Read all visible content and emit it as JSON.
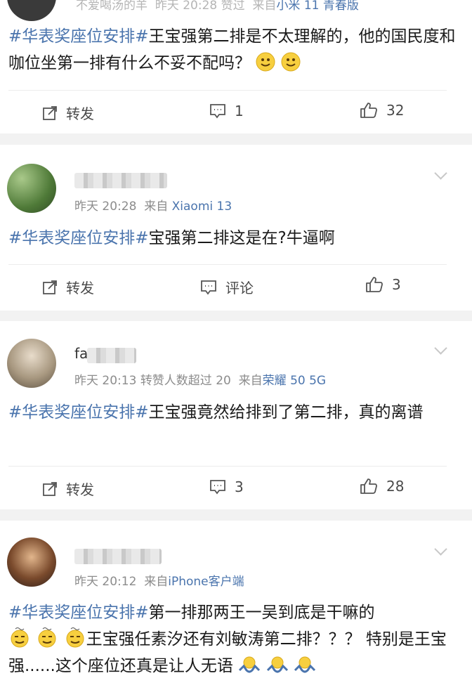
{
  "posts": [
    {
      "username": "不爱喝汤的羊",
      "time": "昨天 20:28",
      "extra": "赞过",
      "source_prefix": "来自",
      "source": "小米 11 青春版",
      "topic": "#华表奖座位安排#",
      "text": "王宝强第二排是不太理解的，他的国民度和咖位坐第一排有什么不妥不配吗？",
      "emoji": [
        "smile-emoji",
        "smile-emoji"
      ],
      "repost_label": "转发",
      "comment_label": "1",
      "like_count": "32"
    },
    {
      "time": "昨天 20:28",
      "source_prefix": "来自",
      "source": "Xiaomi 13",
      "topic": "#华表奖座位安排#",
      "text": "宝强第二排这是在?牛逼啊",
      "repost_label": "转发",
      "comment_label": "评论",
      "like_count": "3"
    },
    {
      "name_prefix": "fa",
      "time": "昨天 20:13",
      "extra": "转赞人数超过 20",
      "source_prefix": "来自",
      "source": "荣耀 50 5G",
      "topic": "#华表奖座位安排#",
      "text": "王宝强竟然给排到了第二排，真的离谱",
      "repost_label": "转发",
      "comment_label": "3",
      "like_count": "28"
    },
    {
      "time": "昨天 20:12",
      "source_prefix": "来自",
      "source": "iPhone客户端",
      "topic": "#华表奖座位安排#",
      "text_a": "第一排那两王一吴到底是干嘛的",
      "text_b": "王宝强任素汐还有刘敏涛第二排？？？ 特别是王宝强......这个座位还真是让人无语",
      "emoji": [
        "dizzy-emoji",
        "shrug-emoji"
      ]
    }
  ]
}
